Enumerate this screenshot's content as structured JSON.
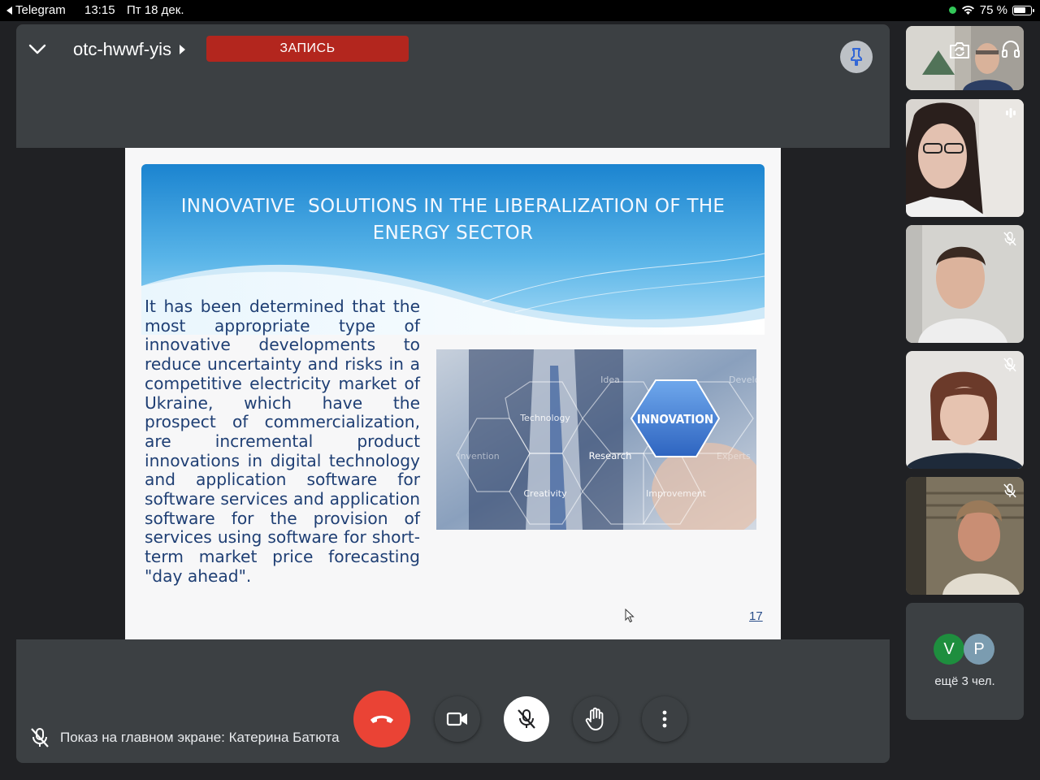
{
  "status_bar": {
    "back_app": "Telegram",
    "time": "13:15",
    "date": "Пт 18 дек.",
    "battery": "75 %",
    "battery_level": 0.75,
    "colors": {
      "mic_active_dot": "#33c759"
    }
  },
  "meeting": {
    "code": "otc-hwwf-yis",
    "recording_label": "ЗАПИСЬ",
    "presenting_text": "Показ на главном экране: Катерина Батюта"
  },
  "slide": {
    "title_line1": "INNOVATIVE  SOLUTIONS IN THE LIBERALIZATION OF THE",
    "title_line2": "ENERGY SECTOR",
    "body": "It has been determined that the most appropriate type of innovative developments to reduce uncertainty and risks in a competitive electricity market of Ukraine, which have the prospect of commercialization, are incremental product innovations in digital technology and application software for software services and application software for the provision of services using software for short-term market price forecasting \"day ahead\".",
    "image_words": {
      "idea": "Idea",
      "develop": "Develop",
      "technology": "Technology",
      "innovation": "INNOVATION",
      "invention": "Invention",
      "research": "Research",
      "experts": "Experts",
      "creativity": "Creativity",
      "improvement": "Improvement"
    },
    "page_number": "17"
  },
  "participants_more": {
    "avatars": [
      {
        "letter": "V",
        "color": "#1e8e3e"
      },
      {
        "letter": "P",
        "color": "#7b9cb0"
      }
    ],
    "label": "ещё 3 чел."
  },
  "icons": {
    "collapse": "chevron-down-icon",
    "pin": "pin-icon",
    "switch_camera": "camera-switch-icon",
    "audio": "headphones-icon",
    "speaking": "audio-level-icon",
    "muted": "mic-off-icon",
    "end_call": "phone-hangup-icon",
    "camera": "videocam-icon",
    "hand": "raise-hand-icon",
    "more": "more-vert-icon"
  }
}
